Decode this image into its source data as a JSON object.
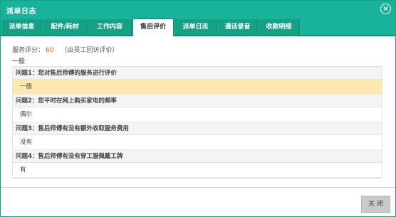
{
  "window": {
    "title": "派单日志",
    "close_icon": "×"
  },
  "tabs": [
    {
      "label": "派单信息",
      "active": false
    },
    {
      "label": "配件/耗材",
      "active": false
    },
    {
      "label": "工作内容",
      "active": false
    },
    {
      "label": "售后评价",
      "active": true
    },
    {
      "label": "派单日志",
      "active": false
    },
    {
      "label": "通话录音",
      "active": false
    },
    {
      "label": "收款明细",
      "active": false
    }
  ],
  "evaluation": {
    "score_label": "服务评分：",
    "score_value": "60",
    "score_note": "（由员工回访评价）",
    "level": "一般"
  },
  "questions": [
    {
      "question": "问题1：您对售后师傅的服务进行评价",
      "answer": "一般"
    },
    {
      "question": "问题2：您平时在网上购买家电的频率",
      "answer": "偶尔"
    },
    {
      "question": "问题3：售后师傅有没有额外收取服务费用",
      "answer": "没有"
    },
    {
      "question": "问题4：售后师傅有没有穿工服佩戴工牌",
      "answer": "有"
    }
  ],
  "footer": {
    "close_button": "关闭"
  },
  "colors": {
    "accent": "#19b39b",
    "highlight": "#fde9b0",
    "score": "#e05c2a"
  }
}
